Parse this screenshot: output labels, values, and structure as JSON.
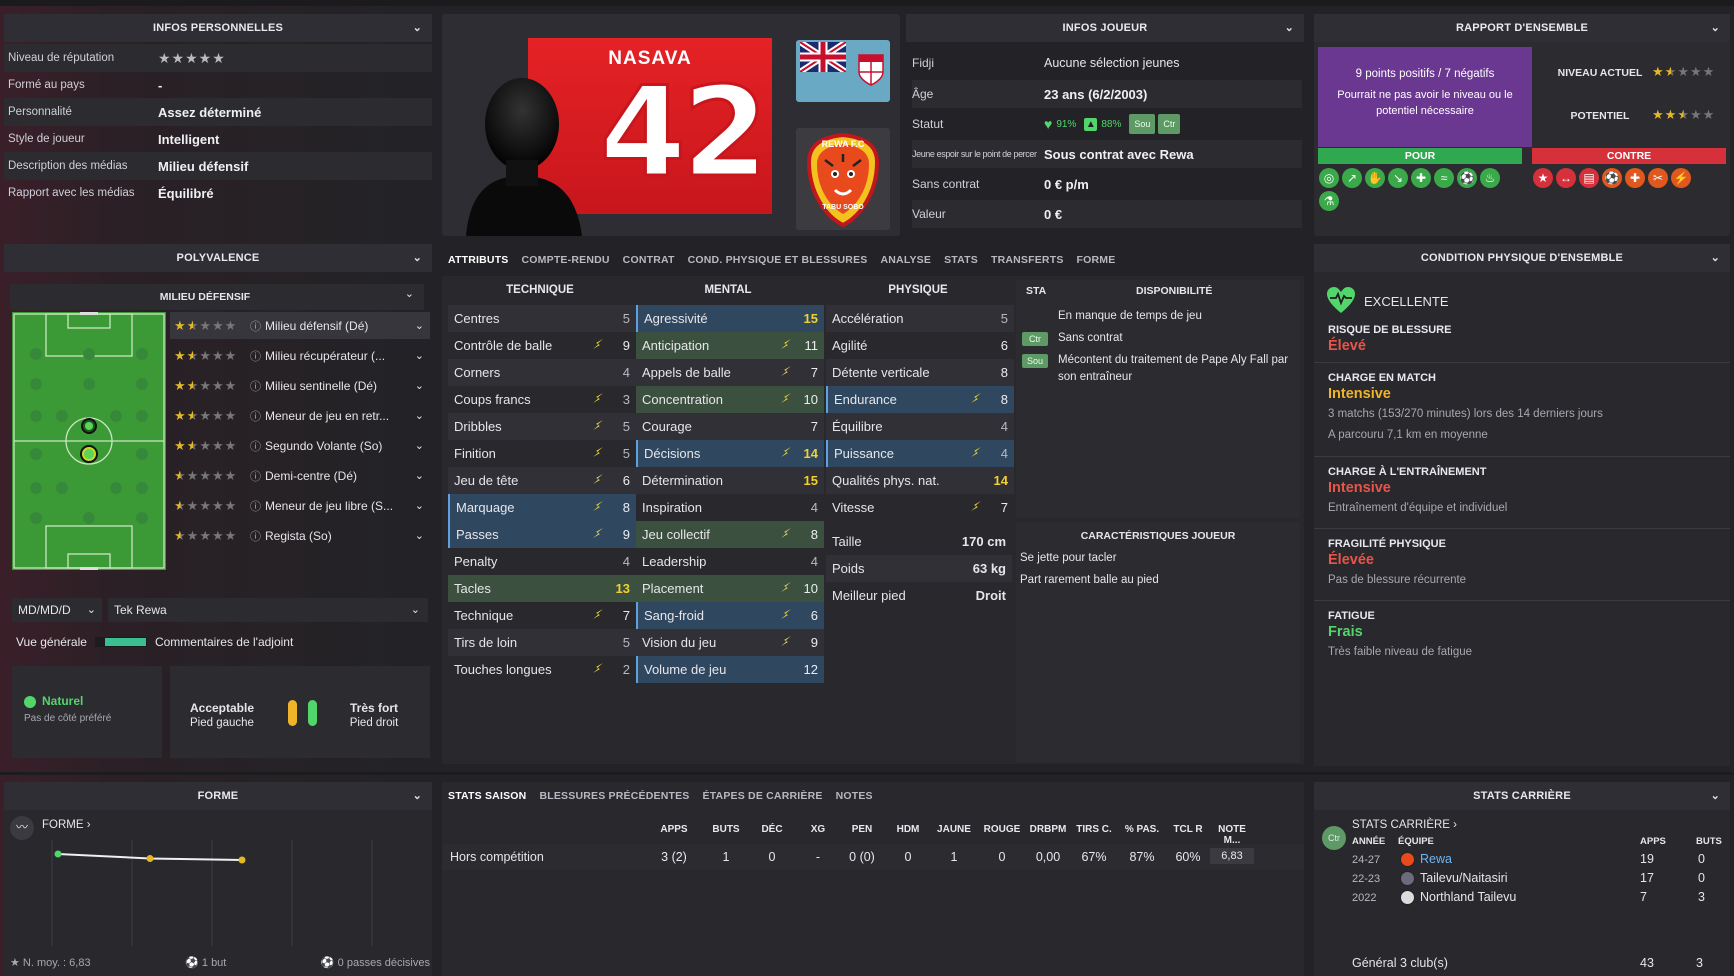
{
  "infos_personnelles": {
    "title": "INFOS PERSONNELLES",
    "rows": [
      {
        "label": "Niveau de réputation",
        "value": "★★★★★",
        "kind": "stars"
      },
      {
        "label": "Formé au pays",
        "value": "-"
      },
      {
        "label": "Personnalité",
        "value": "Assez déterminé"
      },
      {
        "label": "Style de joueur",
        "value": "Intelligent"
      },
      {
        "label": "Description des médias",
        "value": "Milieu défensif"
      },
      {
        "label": "Rapport avec les médias",
        "value": "Équilibré"
      }
    ]
  },
  "player": {
    "name": "NASAVA",
    "number": "42",
    "club_badge_top": "REWA F.C",
    "club_badge_bottom": "TABU SOBO"
  },
  "infos_joueur": {
    "title": "INFOS JOUEUR",
    "country": "Fidji",
    "country_value": "Aucune sélection jeunes",
    "age_label": "Âge",
    "age_value": "23 ans (6/2/2003)",
    "statut_label": "Statut",
    "statut_heart": "91%",
    "statut_up": "88%",
    "tag_sou": "Sou",
    "tag_ctr": "Ctr",
    "espoir_label": "Jeune espoir sur le point de percer",
    "espoir_value": "Sous contrat avec Rewa",
    "contrat_label": "Sans contrat",
    "contrat_value": "0 € p/m",
    "valeur_label": "Valeur",
    "valeur_value": "0 €"
  },
  "rapport": {
    "title": "RAPPORT D'ENSEMBLE",
    "summary": "9 points positifs / 7 négatifs",
    "note": "Pourrait ne pas avoir le niveau ou le potentiel nécessaire",
    "niveau_label": "NIVEAU ACTUEL",
    "niveau_stars": 1.5,
    "potentiel_label": "POTENTIEL",
    "potentiel_stars": 2.5,
    "pour": "POUR",
    "contre": "CONTRE"
  },
  "polyvalence": {
    "title": "POLYVALENCE",
    "subtitle": "MILIEU DÉFENSIF",
    "positions": [
      {
        "name": "Milieu défensif (Dé)",
        "stars": 1.5
      },
      {
        "name": "Milieu récupérateur (...",
        "stars": 1.5
      },
      {
        "name": "Milieu sentinelle (Dé)",
        "stars": 1.5
      },
      {
        "name": "Meneur de jeu en retr...",
        "stars": 1.5
      },
      {
        "name": "Segundo Volante (So)",
        "stars": 1.5
      },
      {
        "name": "Demi-centre (Dé)",
        "stars": 0.5
      },
      {
        "name": "Meneur de jeu libre (S...",
        "stars": 0.5
      },
      {
        "name": "Regista (So)",
        "stars": 0.5
      }
    ],
    "select_left": "MD/MD/D",
    "select_right": "Tek Rewa",
    "vue_generale": "Vue générale",
    "commentaires": "Commentaires de l'adjoint",
    "naturel": "Naturel",
    "naturel_sub": "Pas de côté préféré",
    "foot_left_level": "Acceptable",
    "foot_left": "Pied gauche",
    "foot_right_level": "Très fort",
    "foot_right": "Pied droit"
  },
  "tabs": [
    "ATTRIBUTS",
    "COMPTE-RENDU",
    "CONTRAT",
    "COND. PHYSIQUE ET BLESSURES",
    "ANALYSE",
    "STATS",
    "TRANSFERTS",
    "FORME"
  ],
  "attributes": {
    "technique_title": "TECHNIQUE",
    "mental_title": "MENTAL",
    "physique_title": "PHYSIQUE",
    "technique": [
      {
        "n": "Centres",
        "v": "5",
        "a": false,
        "h": ""
      },
      {
        "n": "Contrôle de balle",
        "v": "9",
        "a": true,
        "h": ""
      },
      {
        "n": "Corners",
        "v": "4",
        "a": false,
        "h": ""
      },
      {
        "n": "Coups francs",
        "v": "3",
        "a": true,
        "h": ""
      },
      {
        "n": "Dribbles",
        "v": "5",
        "a": true,
        "h": ""
      },
      {
        "n": "Finition",
        "v": "5",
        "a": true,
        "h": ""
      },
      {
        "n": "Jeu de tête",
        "v": "6",
        "a": true,
        "h": ""
      },
      {
        "n": "Marquage",
        "v": "8",
        "a": true,
        "h": "hl"
      },
      {
        "n": "Passes",
        "v": "9",
        "a": true,
        "h": "hl"
      },
      {
        "n": "Penalty",
        "v": "4",
        "a": false,
        "h": ""
      },
      {
        "n": "Tacles",
        "v": "13",
        "a": false,
        "h": "hlg"
      },
      {
        "n": "Technique",
        "v": "7",
        "a": true,
        "h": ""
      },
      {
        "n": "Tirs de loin",
        "v": "5",
        "a": false,
        "h": ""
      },
      {
        "n": "Touches longues",
        "v": "2",
        "a": true,
        "h": ""
      }
    ],
    "mental": [
      {
        "n": "Agressivité",
        "v": "15",
        "a": false,
        "h": "hl"
      },
      {
        "n": "Anticipation",
        "v": "11",
        "a": true,
        "h": "hlg"
      },
      {
        "n": "Appels de balle",
        "v": "7",
        "a": true,
        "h": ""
      },
      {
        "n": "Concentration",
        "v": "10",
        "a": true,
        "h": "hlg"
      },
      {
        "n": "Courage",
        "v": "7",
        "a": false,
        "h": ""
      },
      {
        "n": "Décisions",
        "v": "14",
        "a": true,
        "h": "hl"
      },
      {
        "n": "Détermination",
        "v": "15",
        "a": false,
        "h": ""
      },
      {
        "n": "Inspiration",
        "v": "4",
        "a": false,
        "h": ""
      },
      {
        "n": "Jeu collectif",
        "v": "8",
        "a": true,
        "h": "hlg"
      },
      {
        "n": "Leadership",
        "v": "4",
        "a": false,
        "h": ""
      },
      {
        "n": "Placement",
        "v": "10",
        "a": true,
        "h": "hlg"
      },
      {
        "n": "Sang-froid",
        "v": "6",
        "a": true,
        "h": "hl"
      },
      {
        "n": "Vision du jeu",
        "v": "9",
        "a": true,
        "h": ""
      },
      {
        "n": "Volume de jeu",
        "v": "12",
        "a": false,
        "h": "hl"
      }
    ],
    "physique": [
      {
        "n": "Accélération",
        "v": "5",
        "a": false,
        "h": ""
      },
      {
        "n": "Agilité",
        "v": "6",
        "a": false,
        "h": ""
      },
      {
        "n": "Détente verticale",
        "v": "8",
        "a": false,
        "h": ""
      },
      {
        "n": "Endurance",
        "v": "8",
        "a": true,
        "h": "hl"
      },
      {
        "n": "Équilibre",
        "v": "4",
        "a": false,
        "h": ""
      },
      {
        "n": "Puissance",
        "v": "4",
        "a": true,
        "h": "hl"
      },
      {
        "n": "Qualités phys. nat.",
        "v": "14",
        "a": false,
        "h": ""
      },
      {
        "n": "Vitesse",
        "v": "7",
        "a": true,
        "h": ""
      }
    ],
    "taille_label": "Taille",
    "taille": "170 cm",
    "poids_label": "Poids",
    "poids": "63 kg",
    "pied_label": "Meilleur pied",
    "pied": "Droit"
  },
  "disponibilite": {
    "sta": "STA",
    "title": "DISPONIBILITÉ",
    "items": [
      {
        "tag": "",
        "text": "En manque de temps de jeu"
      },
      {
        "tag": "Ctr",
        "text": "Sans contrat"
      },
      {
        "tag": "Sou",
        "text": "Mécontent du traitement de Pape Aly Fall par son entraîneur"
      }
    ]
  },
  "caracteristiques": {
    "title": "CARACTÉRISTIQUES JOUEUR",
    "items": [
      "Se jette pour tacler",
      "Part rarement balle au pied"
    ]
  },
  "condition": {
    "title": "CONDITION PHYSIQUE D'ENSEMBLE",
    "status": "EXCELLENTE",
    "blocks": [
      {
        "t": "RISQUE DE BLESSURE",
        "v": "Élevé",
        "c": "#e8554a",
        "s": []
      },
      {
        "t": "CHARGE EN MATCH",
        "v": "Intensive",
        "c": "#f0b429",
        "s": [
          "3 matchs (153/270 minutes) lors des 14 derniers jours",
          "A parcouru 7,1 km en moyenne"
        ]
      },
      {
        "t": "CHARGE À L'ENTRAÎNEMENT",
        "v": "Intensive",
        "c": "#e8554a",
        "s": [
          "Entraînement d'équipe et individuel"
        ]
      },
      {
        "t": "FRAGILITÉ PHYSIQUE",
        "v": "Élevée",
        "c": "#e8554a",
        "s": [
          "Pas de blessure récurrente"
        ]
      },
      {
        "t": "FATIGUE",
        "v": "Frais",
        "c": "#52d66b",
        "s": [
          "Très faible niveau de fatigue"
        ]
      }
    ]
  },
  "forme": {
    "title": "FORME",
    "label": "FORME ›",
    "chart_points": [
      6.9,
      6.75,
      6.7
    ],
    "moy": "N. moy. : 6,83",
    "buts": "1 but",
    "passes": "0 passes décisives"
  },
  "stats_saison": {
    "tabs": [
      "STATS SAISON",
      "BLESSURES PRÉCÉDENTES",
      "ÉTAPES DE CARRIÈRE",
      "NOTES"
    ],
    "headers": [
      "APPS",
      "BUTS",
      "DÉC",
      "XG",
      "PEN",
      "HDM",
      "JAUNE",
      "ROUGE",
      "DRBPM",
      "TIRS C.",
      "% PAS.",
      "TCL R",
      "NOTE M..."
    ],
    "row_label": "Hors compétition",
    "values": [
      "3 (2)",
      "1",
      "0",
      "-",
      "0 (0)",
      "0",
      "1",
      "0",
      "0,00",
      "67%",
      "87%",
      "60%",
      "6,83"
    ]
  },
  "carriere": {
    "title": "STATS CARRIÈRE",
    "label": "STATS CARRIÈRE ›",
    "h_annee": "ANNÉE",
    "h_equipe": "ÉQUIPE",
    "h_apps": "APPS",
    "h_buts": "BUTS",
    "ctr": "Ctr",
    "rows": [
      {
        "annee": "24-27",
        "equipe": "Rewa",
        "apps": "19",
        "buts": "0"
      },
      {
        "annee": "22-23",
        "equipe": "Tailevu/Naitasiri",
        "apps": "17",
        "buts": "0"
      },
      {
        "annee": "2022",
        "equipe": "Northland Tailevu",
        "apps": "7",
        "buts": "3"
      }
    ],
    "total_label": "Général 3 club(s)",
    "total_apps": "43",
    "total_buts": "3"
  },
  "colors": {
    "accent_blue": "#5ea0e0",
    "pour": "#2fa84f",
    "contre": "#d6303a",
    "gold": "#e3b928",
    "purple": "#6a3791"
  }
}
